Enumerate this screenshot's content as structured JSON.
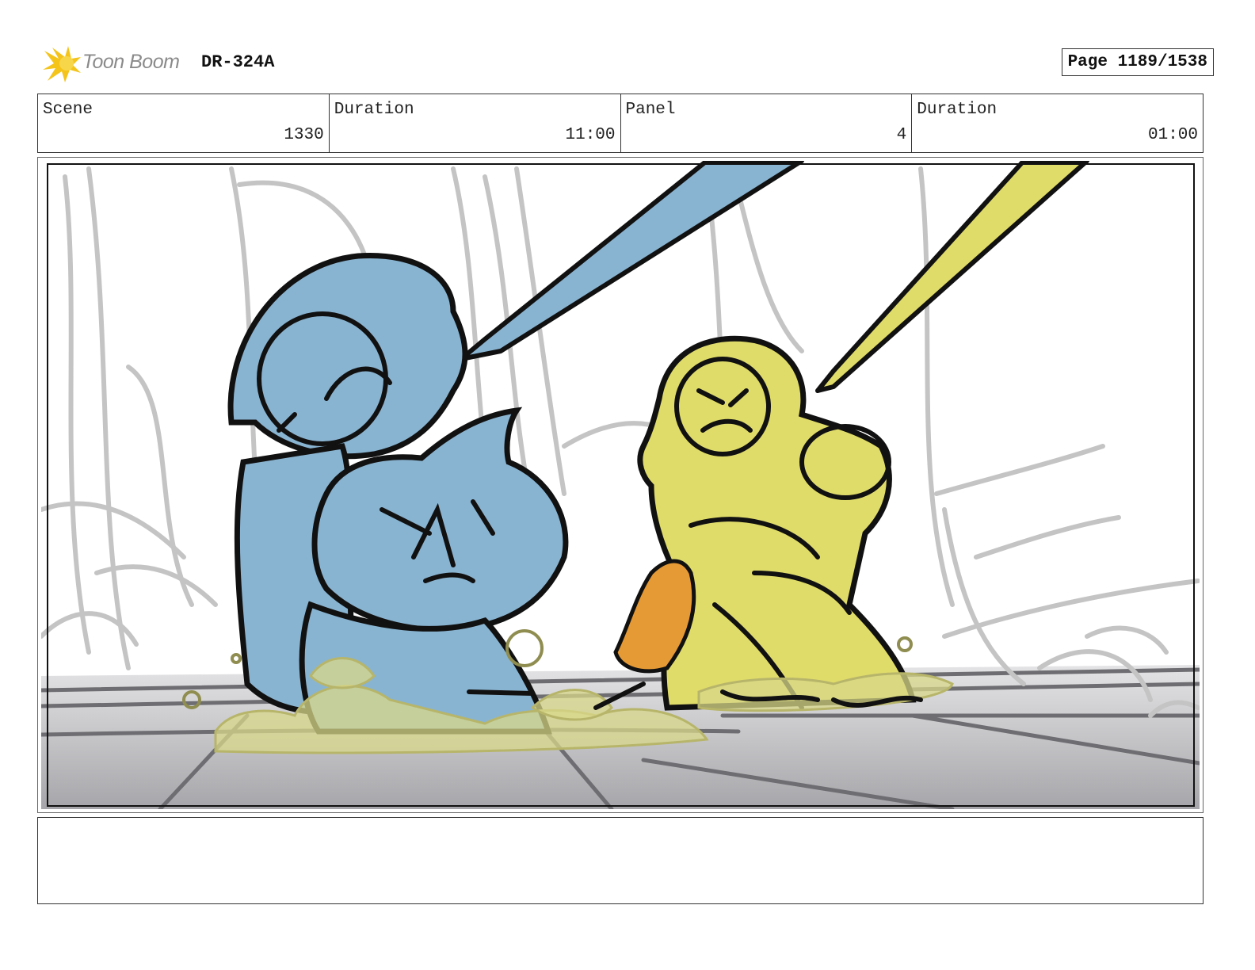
{
  "header": {
    "logo_text": "Toon Boom",
    "doc_id": "DR-324A",
    "page_label": "Page 1189/1538"
  },
  "info": {
    "scene_label": "Scene",
    "scene_value": "1330",
    "scene_duration_label": "Duration",
    "scene_duration_value": "11:00",
    "panel_label": "Panel",
    "panel_value": "4",
    "panel_duration_label": "Duration",
    "panel_duration_value": "01:00"
  },
  "panel": {
    "colors": {
      "blue_character": "#89b4d1",
      "yellow_character": "#e0dc6a",
      "orange_accent": "#e69a35",
      "dust": "#d8d88a",
      "background_lines": "#c4c4c4",
      "floor_light": "#e2e2e4",
      "floor_dark": "#a9a9ad",
      "ink": "#111111"
    }
  },
  "notes": {
    "text": ""
  }
}
